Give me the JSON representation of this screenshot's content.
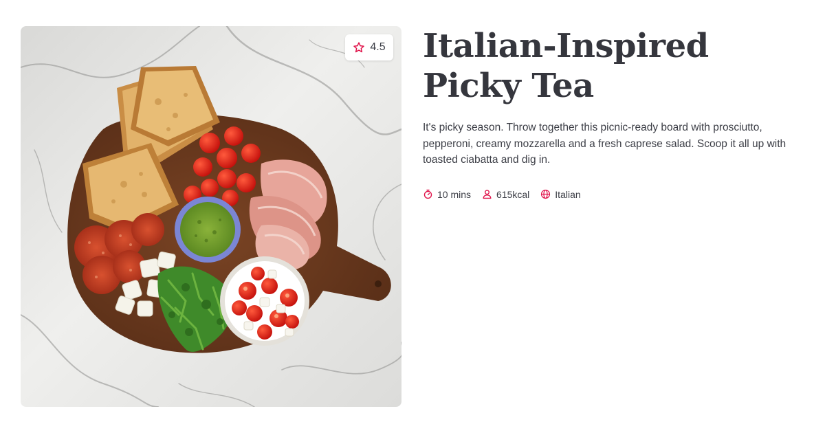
{
  "recipe": {
    "title": "Italian-Inspired Picky Tea",
    "description": "It's picky season. Throw together this picnic-ready board with prosciutto, pepperoni, creamy mozzarella and a fresh caprese salad. Scoop it all up with toasted ciabatta and dig in.",
    "rating": "4.5",
    "image_alt": "Italian picky tea board with ciabatta, tomatoes, prosciutto, pesto, pepperoni, mozzarella, rocket and caprese salad on marble",
    "meta": [
      {
        "icon": "timer-icon",
        "label": "10 mins"
      },
      {
        "icon": "person-icon",
        "label": "615kcal"
      },
      {
        "icon": "globe-icon",
        "label": "Italian"
      }
    ]
  },
  "colors": {
    "accent": "#e0134a",
    "text": "#35363d",
    "board": "#6b3a1f",
    "marble": "#e9e9e7"
  }
}
